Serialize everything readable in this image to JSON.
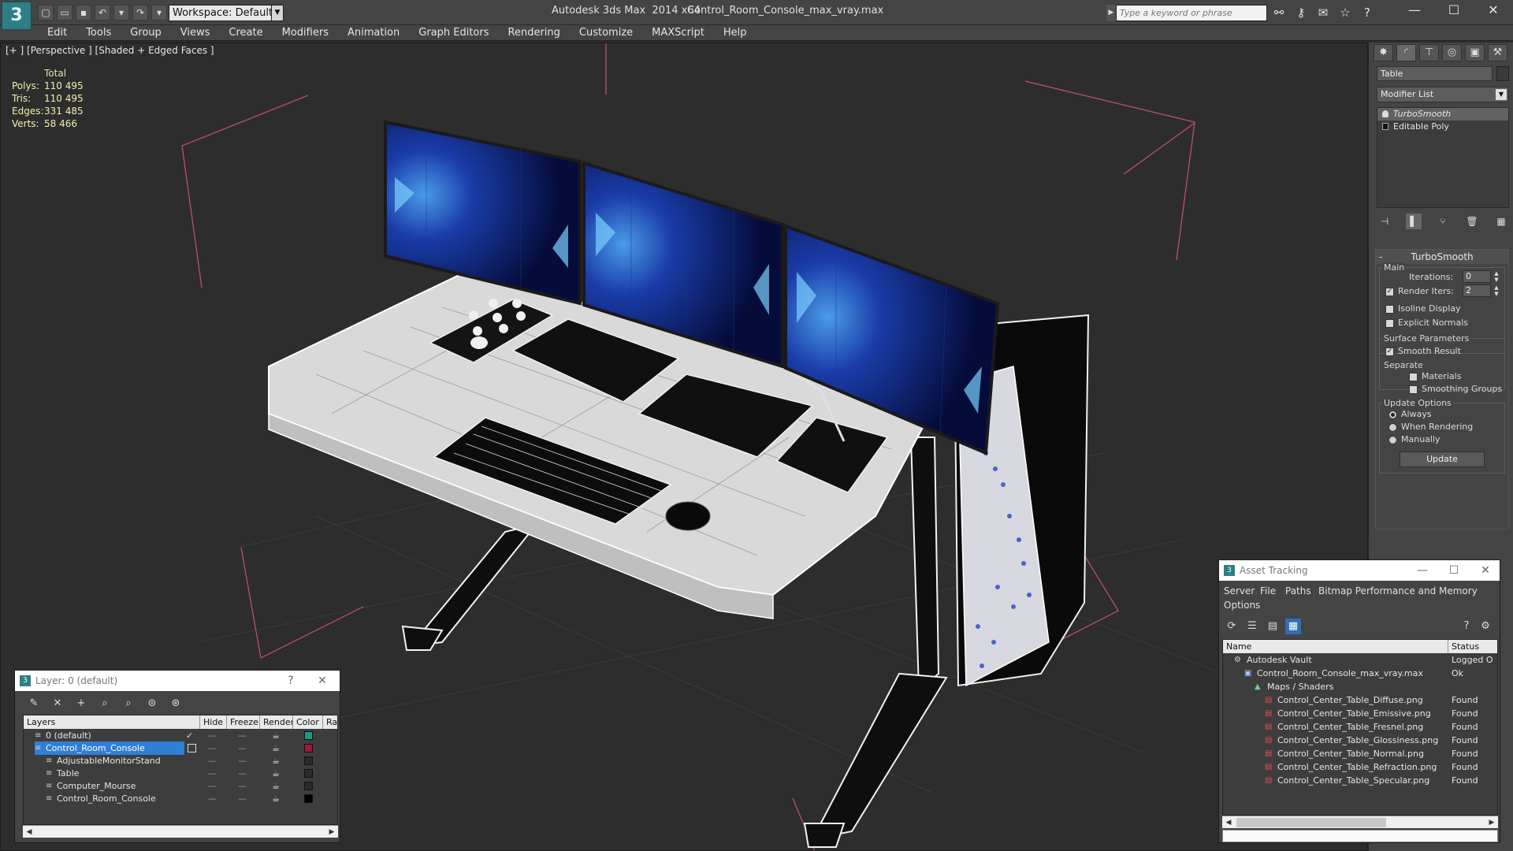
{
  "app": {
    "title": "Autodesk 3ds Max  2014 x64",
    "file": "Control_Room_Console_max_vray.max",
    "logo_glyph": "3",
    "workspace": "Workspace: Default",
    "search_placeholder": "Type a keyword or phrase"
  },
  "menu": [
    "Edit",
    "Tools",
    "Group",
    "Views",
    "Create",
    "Modifiers",
    "Animation",
    "Graph Editors",
    "Rendering",
    "Customize",
    "MAXScript",
    "Help"
  ],
  "viewport": {
    "label": "[+ ] [Perspective ] [Shaded + Edged Faces ]",
    "stats": {
      "header": "Total",
      "rows": [
        {
          "key": "Polys:",
          "value": "110 495"
        },
        {
          "key": "Tris:",
          "value": "110 495"
        },
        {
          "key": "Edges:",
          "value": "331 485"
        },
        {
          "key": "Verts:",
          "value": "58 466"
        }
      ]
    }
  },
  "command_panel": {
    "object_name": "Table",
    "modifier_list": "Modifier List",
    "stack": [
      "TurboSmooth",
      "Editable Poly"
    ],
    "rollout_title": "TurboSmooth",
    "main_label": "Main",
    "iterations_label": "Iterations:",
    "iterations_value": "0",
    "render_iters_label": "Render Iters:",
    "render_iters_value": "2",
    "isoline_label": "Isoline Display",
    "explicit_label": "Explicit Normals",
    "surface_label": "Surface Parameters",
    "smooth_result_label": "Smooth Result",
    "separate_label": "Separate",
    "materials_label": "Materials",
    "smoothing_groups_label": "Smoothing Groups",
    "update_options_label": "Update Options",
    "always_label": "Always",
    "when_rendering_label": "When Rendering",
    "manually_label": "Manually",
    "update_button": "Update"
  },
  "layer_window": {
    "title": "Layer: 0 (default)",
    "help": "?",
    "columns": [
      "Layers",
      "Hide",
      "Freeze",
      "Render",
      "Color",
      "Ra"
    ],
    "rows": [
      {
        "name": "0 (default)",
        "color": "#1a9a86",
        "indent": 1
      },
      {
        "name": "Control_Room_Console",
        "color": "#a0183a",
        "indent": 1,
        "selected": true
      },
      {
        "name": "AdjustableMonitorStand",
        "color": "#2a2a2a",
        "indent": 2
      },
      {
        "name": "Table",
        "color": "#2a2a2a",
        "indent": 2
      },
      {
        "name": "Computer_Mourse",
        "color": "#2a2a2a",
        "indent": 2
      },
      {
        "name": "Control_Room_Console",
        "color": "#000000",
        "indent": 2
      }
    ]
  },
  "asset_window": {
    "title": "Asset Tracking",
    "menus": [
      "Server",
      "File",
      "Paths",
      "Bitmap Performance and Memory"
    ],
    "menu_row2": "Options",
    "columns": [
      "Name",
      "Status"
    ],
    "rows": [
      {
        "name": "Autodesk Vault",
        "status": "Logged O",
        "indent": 0
      },
      {
        "name": "Control_Room_Console_max_vray.max",
        "status": "Ok",
        "indent": 1
      },
      {
        "name": "Maps / Shaders",
        "status": "",
        "indent": 2
      },
      {
        "name": "Control_Center_Table_Diffuse.png",
        "status": "Found",
        "indent": 3
      },
      {
        "name": "Control_Center_Table_Emissive.png",
        "status": "Found",
        "indent": 3
      },
      {
        "name": "Control_Center_Table_Fresnel.png",
        "status": "Found",
        "indent": 3
      },
      {
        "name": "Control_Center_Table_Glossiness.png",
        "status": "Found",
        "indent": 3
      },
      {
        "name": "Control_Center_Table_Normal.png",
        "status": "Found",
        "indent": 3
      },
      {
        "name": "Control_Center_Table_Refraction.png",
        "status": "Found",
        "indent": 3
      },
      {
        "name": "Control_Center_Table_Specular.png",
        "status": "Found",
        "indent": 3
      }
    ]
  },
  "colors": {
    "accent": "#2e7e86",
    "selection": "#2f7fd6",
    "stats_text": "#f0f0b0",
    "bbox_lines": "#d05070"
  }
}
